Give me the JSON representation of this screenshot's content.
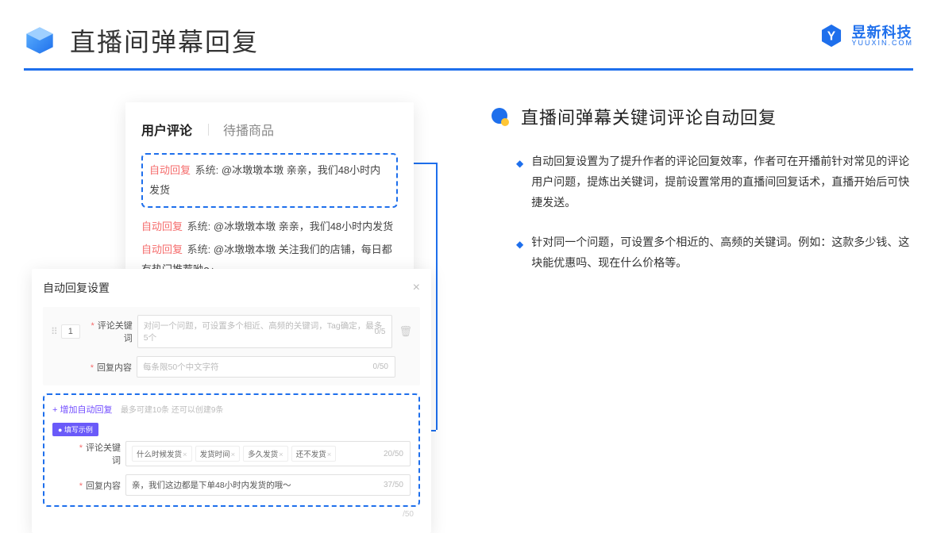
{
  "page_title": "直播间弹幕回复",
  "brand": {
    "cn": "昱新科技",
    "en": "YUUXIN.COM"
  },
  "comments_card": {
    "tabs": [
      "用户评论",
      "待播商品"
    ],
    "highlighted": {
      "auto": "自动回复",
      "sys": "系统:",
      "text": " @冰墩墩本墩 亲亲，我们48小时内发货"
    },
    "lines": [
      {
        "auto": "自动回复",
        "sys": "系统:",
        "text": " @冰墩墩本墩 亲亲，我们48小时内发货"
      },
      {
        "auto": "自动回复",
        "sys": "系统:",
        "text": " @冰墩墩本墩 关注我们的店铺，每日都有热门推荐呦～"
      }
    ]
  },
  "settings_card": {
    "title": "自动回复设置",
    "row_num": "1",
    "kw_label": "评论关键词",
    "kw_placeholder": "对问一个问题，可设置多个相近、高频的关键词，Tag确定，最多5个",
    "kw_count": "0/5",
    "content_label": "回复内容",
    "content_placeholder": "每条限50个中文字符",
    "content_count": "0/50",
    "add_link": "+ 增加自动回复",
    "add_note": "最多可建10条 还可以创建9条",
    "example_badge": "● 填写示例",
    "example_kw_label": "评论关键词",
    "example_kw_chips": [
      "什么时候发货",
      "发货时间",
      "多久发货",
      "还不发货"
    ],
    "example_kw_count": "20/50",
    "example_ct_label": "回复内容",
    "example_ct_text": "亲，我们这边都是下单48小时内发货的哦～",
    "example_ct_count": "37/50",
    "lower_count": "/50"
  },
  "right": {
    "section_title": "直播间弹幕关键词评论自动回复",
    "bullets": [
      "自动回复设置为了提升作者的评论回复效率，作者可在开播前针对常见的评论用户问题，提炼出关键词，提前设置常用的直播间回复话术，直播开始后可快捷发送。",
      "针对同一个问题，可设置多个相近的、高频的关键词。例如：这款多少钱、这块能优惠吗、现在什么价格等。"
    ]
  }
}
